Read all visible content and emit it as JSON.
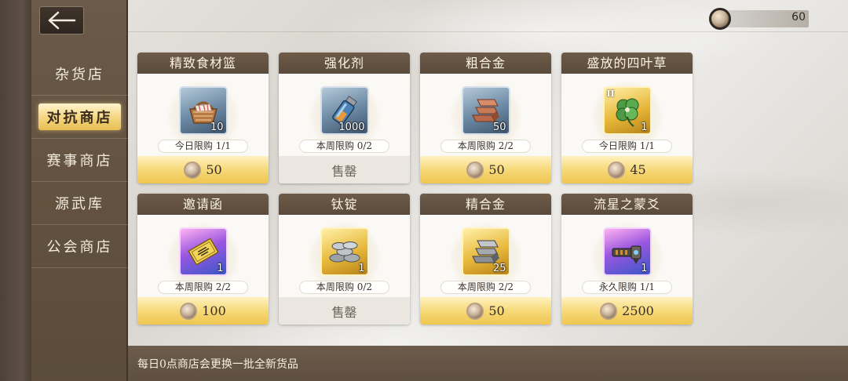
{
  "currency": {
    "amount": "60",
    "icon": "coin-icon"
  },
  "nav": {
    "back_icon": "arrow-left-icon",
    "items": [
      {
        "label": "杂货店",
        "active": false
      },
      {
        "label": "对抗商店",
        "active": true
      },
      {
        "label": "赛事商店",
        "active": false
      },
      {
        "label": "源武库",
        "active": false
      },
      {
        "label": "公会商店",
        "active": false
      }
    ]
  },
  "shop": {
    "items": [
      {
        "name": "精致食材篮",
        "qty": "10",
        "limit": "今日限购 1/1",
        "price": "50",
        "sold_out": false,
        "rarity": "blue",
        "icon": "basket-icon"
      },
      {
        "name": "强化剂",
        "qty": "1000",
        "limit": "本周限购 0/2",
        "price": "售罄",
        "sold_out": true,
        "rarity": "blue",
        "icon": "vial-icon"
      },
      {
        "name": "粗合金",
        "qty": "50",
        "limit": "本周限购 2/2",
        "price": "50",
        "sold_out": false,
        "rarity": "blue",
        "icon": "copper-ingots-icon"
      },
      {
        "name": "盛放的四叶草",
        "qty": "1",
        "tier": "II",
        "limit": "今日限购 1/1",
        "price": "45",
        "sold_out": false,
        "rarity": "gold",
        "icon": "clover-icon"
      },
      {
        "name": "邀请函",
        "qty": "1",
        "limit": "本周限购 2/2",
        "price": "100",
        "sold_out": false,
        "rarity": "purple",
        "icon": "invitation-icon"
      },
      {
        "name": "钛锭",
        "qty": "1",
        "limit": "本周限购 0/2",
        "price": "售罄",
        "sold_out": true,
        "rarity": "gold",
        "icon": "titanium-coins-icon"
      },
      {
        "name": "精合金",
        "qty": "25",
        "limit": "本周限购 2/2",
        "price": "50",
        "sold_out": false,
        "rarity": "gold",
        "icon": "silver-ingots-icon"
      },
      {
        "name": "流星之蒙爻",
        "qty": "1",
        "limit": "永久限购 1/1",
        "price": "2500",
        "sold_out": false,
        "rarity": "purple",
        "icon": "cannon-icon"
      }
    ]
  },
  "footer": {
    "notice": "每日0点商店会更换一批全新货品"
  }
}
